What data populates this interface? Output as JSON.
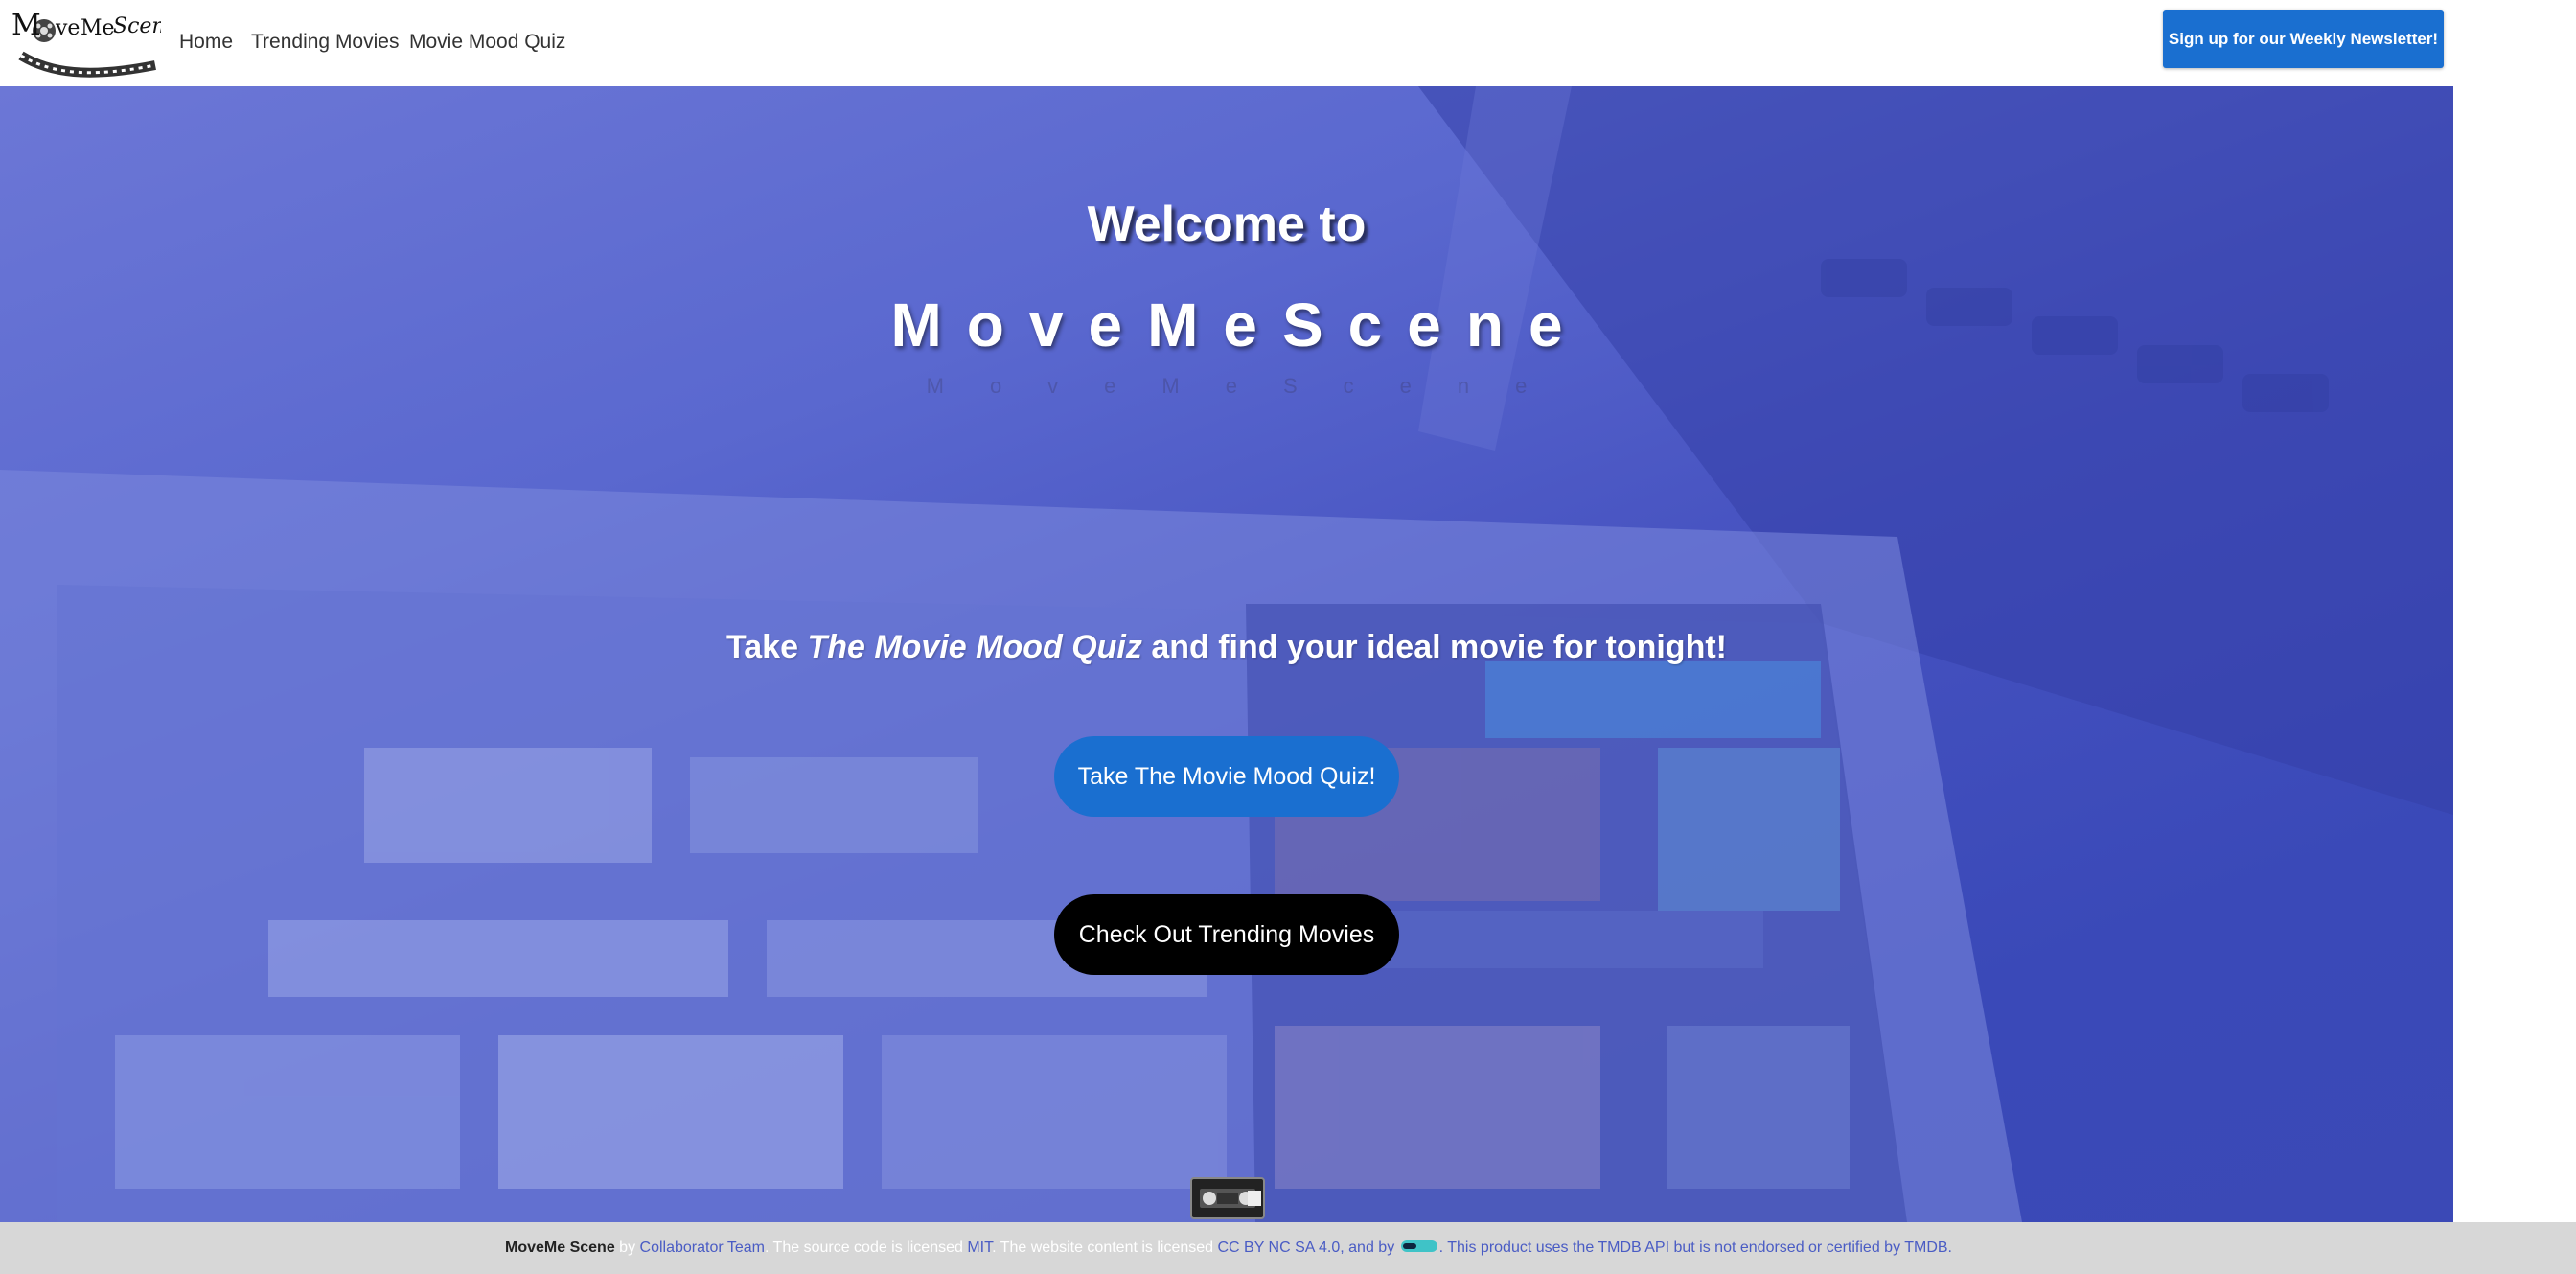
{
  "nav": {
    "logo_text": "MoveMeScene",
    "links": [
      "Home",
      "Trending Movies",
      "Movie Mood Quiz"
    ],
    "newsletter_label": "Sign up for our Weekly Newsletter!"
  },
  "hero": {
    "welcome": "Welcome to",
    "brand": "MoveMeScene",
    "brand_reflection": "MoveMeScene",
    "tagline_prefix": "Take ",
    "tagline_em": "The Movie Mood Quiz",
    "tagline_suffix": " and find your ideal movie for tonight!",
    "quiz_button": "Take The Movie Mood Quiz!",
    "trending_button": "Check Out Trending Movies"
  },
  "footer": {
    "site_name": "MoveMe Scene",
    "by": " by ",
    "team_link": "Collaborator Team",
    "code_text": ". The source code is licensed ",
    "mit_link": "MIT",
    "content_text": ". The website content is licensed ",
    "cc_link": "CC BY NC SA 4.0",
    "and_by": ", and by ",
    "tmdb_text": ". This product uses the TMDB API but is not endorsed or certified by TMDB."
  },
  "colors": {
    "accent": "#1a6fd0",
    "hero_overlay": "#4a58c4",
    "footer_bg": "#d7d7d7",
    "link": "#4a5cc4"
  },
  "icons": {
    "logo": "film-reel-logo",
    "vhs": "vhs-tape-icon",
    "tmdb": "tmdb-logo-icon"
  }
}
